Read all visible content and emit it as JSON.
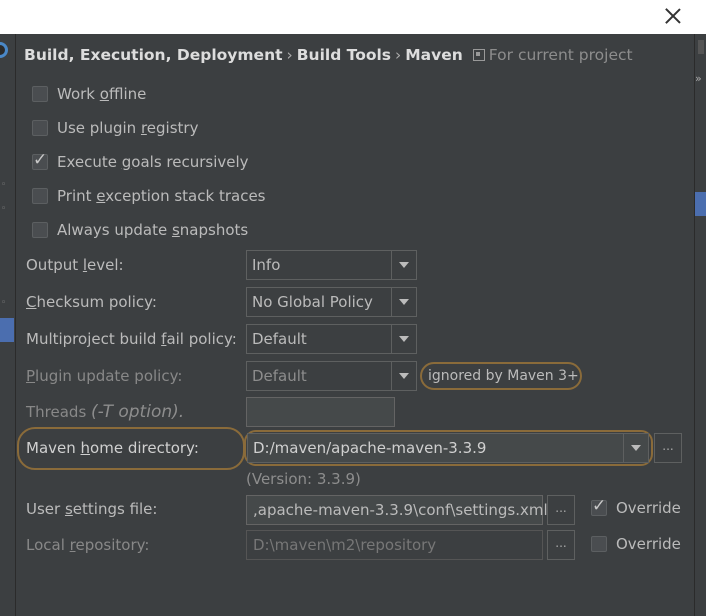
{
  "window": {
    "close_label": "✕"
  },
  "header": {
    "crumbs": [
      "Build, Execution, Deployment",
      "Build Tools",
      "Maven"
    ],
    "separator": "›",
    "scope": "For current project"
  },
  "checkboxes": [
    {
      "pre": "Work ",
      "mn": "o",
      "post": "ffline",
      "checked": false
    },
    {
      "pre": "Use plugin ",
      "mn": "r",
      "post": "egistry",
      "checked": false
    },
    {
      "pre": "Execute ",
      "mn": "g",
      "post": "oals recursively",
      "checked": true
    },
    {
      "pre": "Print ",
      "mn": "e",
      "post": "xception stack traces",
      "checked": false
    },
    {
      "pre": "Always update ",
      "mn": "s",
      "post": "napshots",
      "checked": false
    }
  ],
  "fields": {
    "output_level": {
      "pre": "Output ",
      "mn": "l",
      "post": "evel:",
      "value": "Info"
    },
    "checksum_policy": {
      "pre": "",
      "mn": "C",
      "post": "hecksum policy:",
      "value": "No Global Policy"
    },
    "fail_policy": {
      "pre": "Multiproject build ",
      "mn": "f",
      "post": "ail policy:",
      "value": "Default"
    },
    "plugin_update": {
      "pre": "",
      "mn": "P",
      "post": "lugin update policy:",
      "value": "Default",
      "hint": "ignored by Maven 3+"
    },
    "threads": {
      "label": "Threads",
      "hint": "(-T option).",
      "value": ""
    },
    "maven_home": {
      "pre": "Maven ",
      "mn": "h",
      "post": "ome directory:",
      "value": "D:/maven/apache-maven-3.3.9",
      "version": "(Version: 3.3.9)"
    },
    "user_settings": {
      "pre": "User ",
      "mn": "s",
      "post": "ettings file:",
      "value": ",apache-maven-3.3.9\\conf\\settings.xml",
      "override_label": "Override",
      "override_checked": true
    },
    "local_repo": {
      "pre": "Local ",
      "mn": "r",
      "post": "epository:",
      "value": "D:\\maven\\m2\\repository",
      "override_label": "Override",
      "override_checked": false
    }
  },
  "browse_label": "...",
  "colors": {
    "background": "#3c3f41",
    "highlight": "#8a6b3a",
    "selection": "#4b6eaf",
    "text": "#bbbbbb"
  }
}
